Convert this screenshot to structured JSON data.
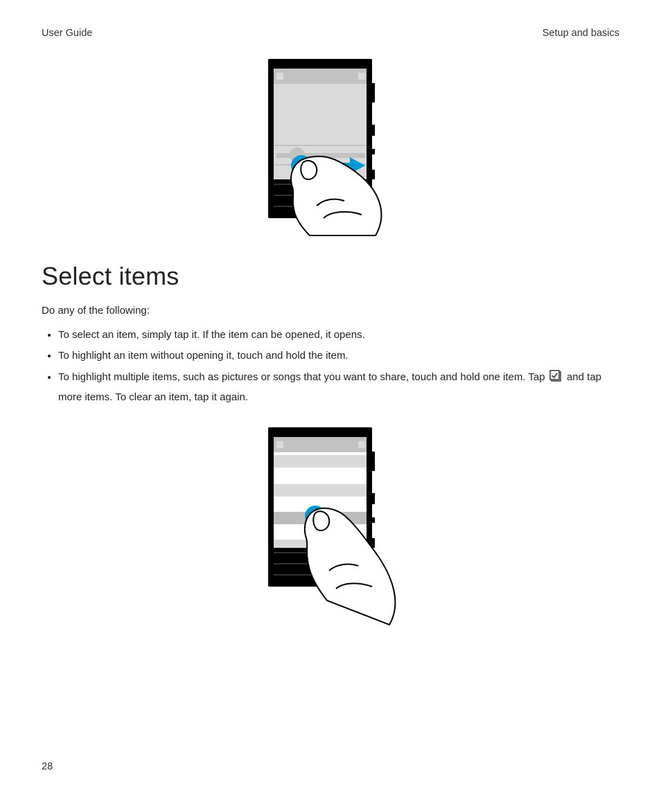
{
  "header": {
    "left": "User Guide",
    "right": "Setup and basics"
  },
  "heading": "Select items",
  "intro": "Do any of the following:",
  "bullets": [
    "To select an item, simply tap it. If the item can be opened, it opens.",
    "To highlight an item without opening it, touch and hold the item."
  ],
  "bullet3": {
    "pre": "To highlight multiple items, such as pictures or songs that you want to share, touch and hold one item. Tap ",
    "post": " and tap more items. To clear an item, tap it again."
  },
  "icons": {
    "checkbox": "checkbox-select-icon"
  },
  "figures": {
    "top": "gesture-swipe-right-illustration",
    "bottom": "gesture-tap-hold-illustration"
  },
  "colors": {
    "accent": "#0099d6",
    "text": "#222222"
  },
  "page_number": "28"
}
